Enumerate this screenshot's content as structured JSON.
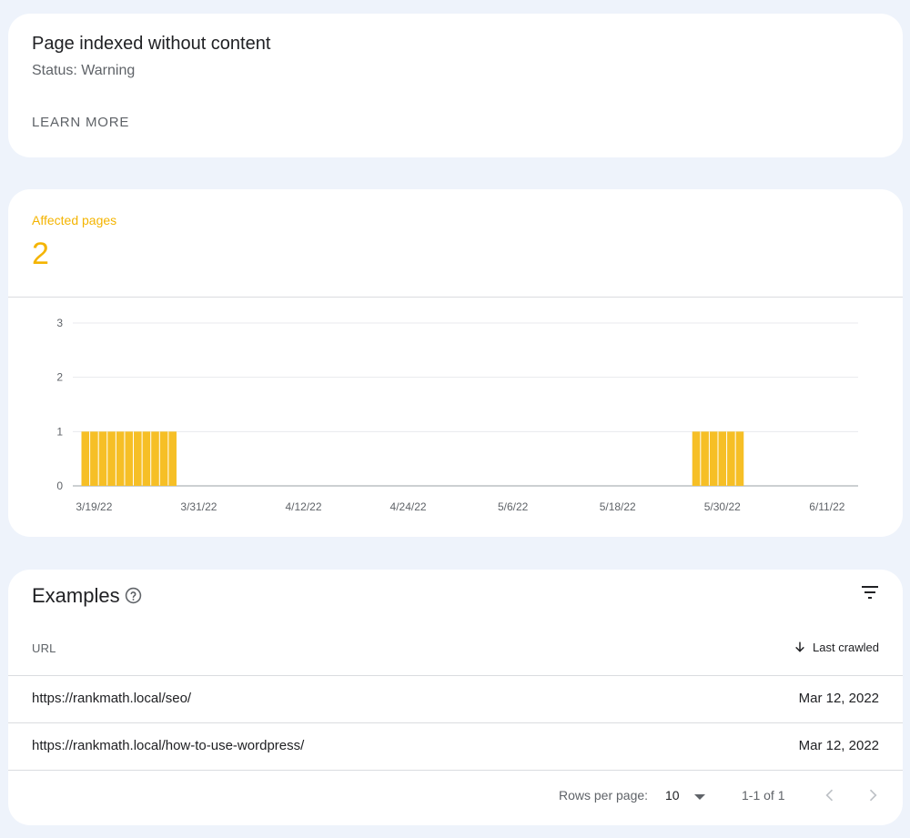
{
  "status_card": {
    "title": "Page indexed without content",
    "status": "Status: Warning",
    "learn_more": "LEARN MORE"
  },
  "affected": {
    "label": "Affected pages",
    "value": "2",
    "accent_color": "#f4b400"
  },
  "chart_data": {
    "type": "bar",
    "ylim": [
      0,
      3
    ],
    "yticks": [
      "0",
      "1",
      "2",
      "3"
    ],
    "xtick_labels": [
      "3/19/22",
      "3/31/22",
      "4/12/22",
      "4/24/22",
      "5/6/22",
      "5/18/22",
      "5/30/22",
      "6/11/22"
    ],
    "x_start": "3/18/22",
    "x_end": "6/15/22",
    "bar_color": "#f6bf26",
    "series": [
      {
        "values": [
          {
            "x": "3/18/22",
            "y": 1
          },
          {
            "x": "3/19/22",
            "y": 1
          },
          {
            "x": "3/20/22",
            "y": 1
          },
          {
            "x": "3/21/22",
            "y": 1
          },
          {
            "x": "3/22/22",
            "y": 1
          },
          {
            "x": "3/23/22",
            "y": 1
          },
          {
            "x": "3/24/22",
            "y": 1
          },
          {
            "x": "3/25/22",
            "y": 1
          },
          {
            "x": "3/26/22",
            "y": 1
          },
          {
            "x": "3/27/22",
            "y": 1
          },
          {
            "x": "3/28/22",
            "y": 1
          },
          {
            "x": "5/27/22",
            "y": 1
          },
          {
            "x": "5/28/22",
            "y": 1
          },
          {
            "x": "5/29/22",
            "y": 1
          },
          {
            "x": "5/30/22",
            "y": 1
          },
          {
            "x": "5/31/22",
            "y": 1
          },
          {
            "x": "6/1/22",
            "y": 1
          }
        ]
      }
    ]
  },
  "examples": {
    "title": "Examples",
    "col_url": "URL",
    "col_last_crawled": "Last crawled",
    "rows": [
      {
        "url": "https://rankmath.local/seo/",
        "date": "Mar 12, 2022"
      },
      {
        "url": "https://rankmath.local/how-to-use-wordpress/",
        "date": "Mar 12, 2022"
      }
    ],
    "pagination": {
      "rows_per_page_label": "Rows per page:",
      "rows_per_page_value": "10",
      "range": "1-1 of 1"
    }
  }
}
